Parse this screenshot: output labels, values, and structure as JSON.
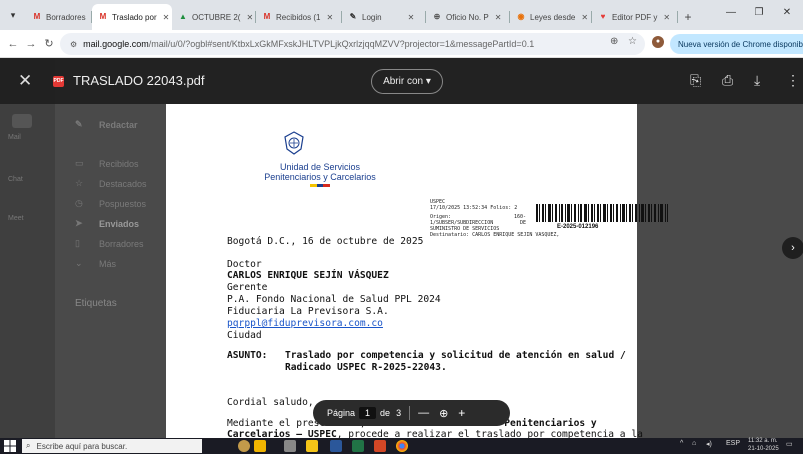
{
  "tabs": [
    {
      "label": "Borradores",
      "icon": "gmail-icon",
      "active": false
    },
    {
      "label": "Traslado por",
      "icon": "gmail-icon",
      "active": true
    },
    {
      "label": "OCTUBRE 2(",
      "icon": "drive-icon",
      "active": false
    },
    {
      "label": "Recibidos (1",
      "icon": "gmail-icon",
      "active": false
    },
    {
      "label": "Login",
      "icon": "login-icon",
      "active": false
    },
    {
      "label": "Oficio No. P",
      "icon": "globe-icon",
      "active": false
    },
    {
      "label": "Leyes desde",
      "icon": "leyes-icon",
      "active": false
    },
    {
      "label": "Editor PDF y",
      "icon": "heart-icon",
      "active": false
    }
  ],
  "address": {
    "url_host": "mail.google.com",
    "url_rest": "/mail/u/0/?ogbl#sent/KtbxLxGkMFxskJHLTVPLjkQxrlzjqqMZVV?projector=1&messagePartId=0.1",
    "update_label": "Nueva versión de Chrome disponible"
  },
  "gmail_sidebar": {
    "left": [
      "Mail",
      "Chat",
      "Meet"
    ],
    "compose": "Redactar",
    "items": [
      "Recibidos",
      "Destacados",
      "Pospuestos",
      "Enviados",
      "Borradores",
      "Más"
    ],
    "labels_title": "Etiquetas"
  },
  "viewer": {
    "filename": "TRASLADO 22043.pdf",
    "open_with": "Abrir con"
  },
  "letter": {
    "org_line1": "Unidad de Servicios",
    "org_line2": "Penitenciarios y Carcelarios",
    "stamp": {
      "line1": "USPEC",
      "line2": "17/10/2025 13:52:34 Folios: 2",
      "line3": "Origen:",
      "line4": "1/SUBSER/SUBDIRECCION",
      "line5": "SUMINISTRO DE SERVICIOS",
      "line6": "Destinatario: CARLOS ENRIQUE  SEJIN VASQUEZ,",
      "col_a": "160-",
      "col_b": "DE",
      "radicado": "E-2025-012196"
    },
    "place_date": "Bogotá D.C., 16 de octubre de 2025",
    "salutation_title": "Doctor",
    "recipient_name": "CARLOS ENRIQUE SEJÍN VÁSQUEZ",
    "recipient_role": "Gerente",
    "recipient_org1": "P.A. Fondo Nacional de Salud PPL 2024",
    "recipient_org2": "Fiduciaria La Previsora S.A.",
    "recipient_email": "pqrppl@fiduprevisora.com.co",
    "recipient_city": "Ciudad",
    "subject_label": "ASUNTO:",
    "subject_line1": "Traslado por competencia y solicitud de atención en salud /",
    "subject_line2": "Radicado USPEC R-2025-22043.",
    "greeting": "Cordial saludo,",
    "body_line1_a": "Mediante el prese",
    "body_line1_b": "oficio, la ",
    "body_line1_c": "Unidad de Servicios Penitenciarios y",
    "body_line2_a": "Carcelarios – USPEC",
    "body_line2_b": ", procede a realizar el traslado por competencia a la"
  },
  "pager": {
    "label": "Página",
    "current": "1",
    "of": "de",
    "total": "3",
    "minus": "—",
    "plus": "+"
  },
  "taskbar": {
    "search_placeholder": "Escribe aquí para buscar.",
    "lang": "ESP",
    "time": "11:32 a. m.",
    "date": "21-10-2025"
  },
  "colors": {
    "accent_blue": "#1b3f8f",
    "link": "#1a55c9",
    "pdf_red": "#e53935"
  }
}
